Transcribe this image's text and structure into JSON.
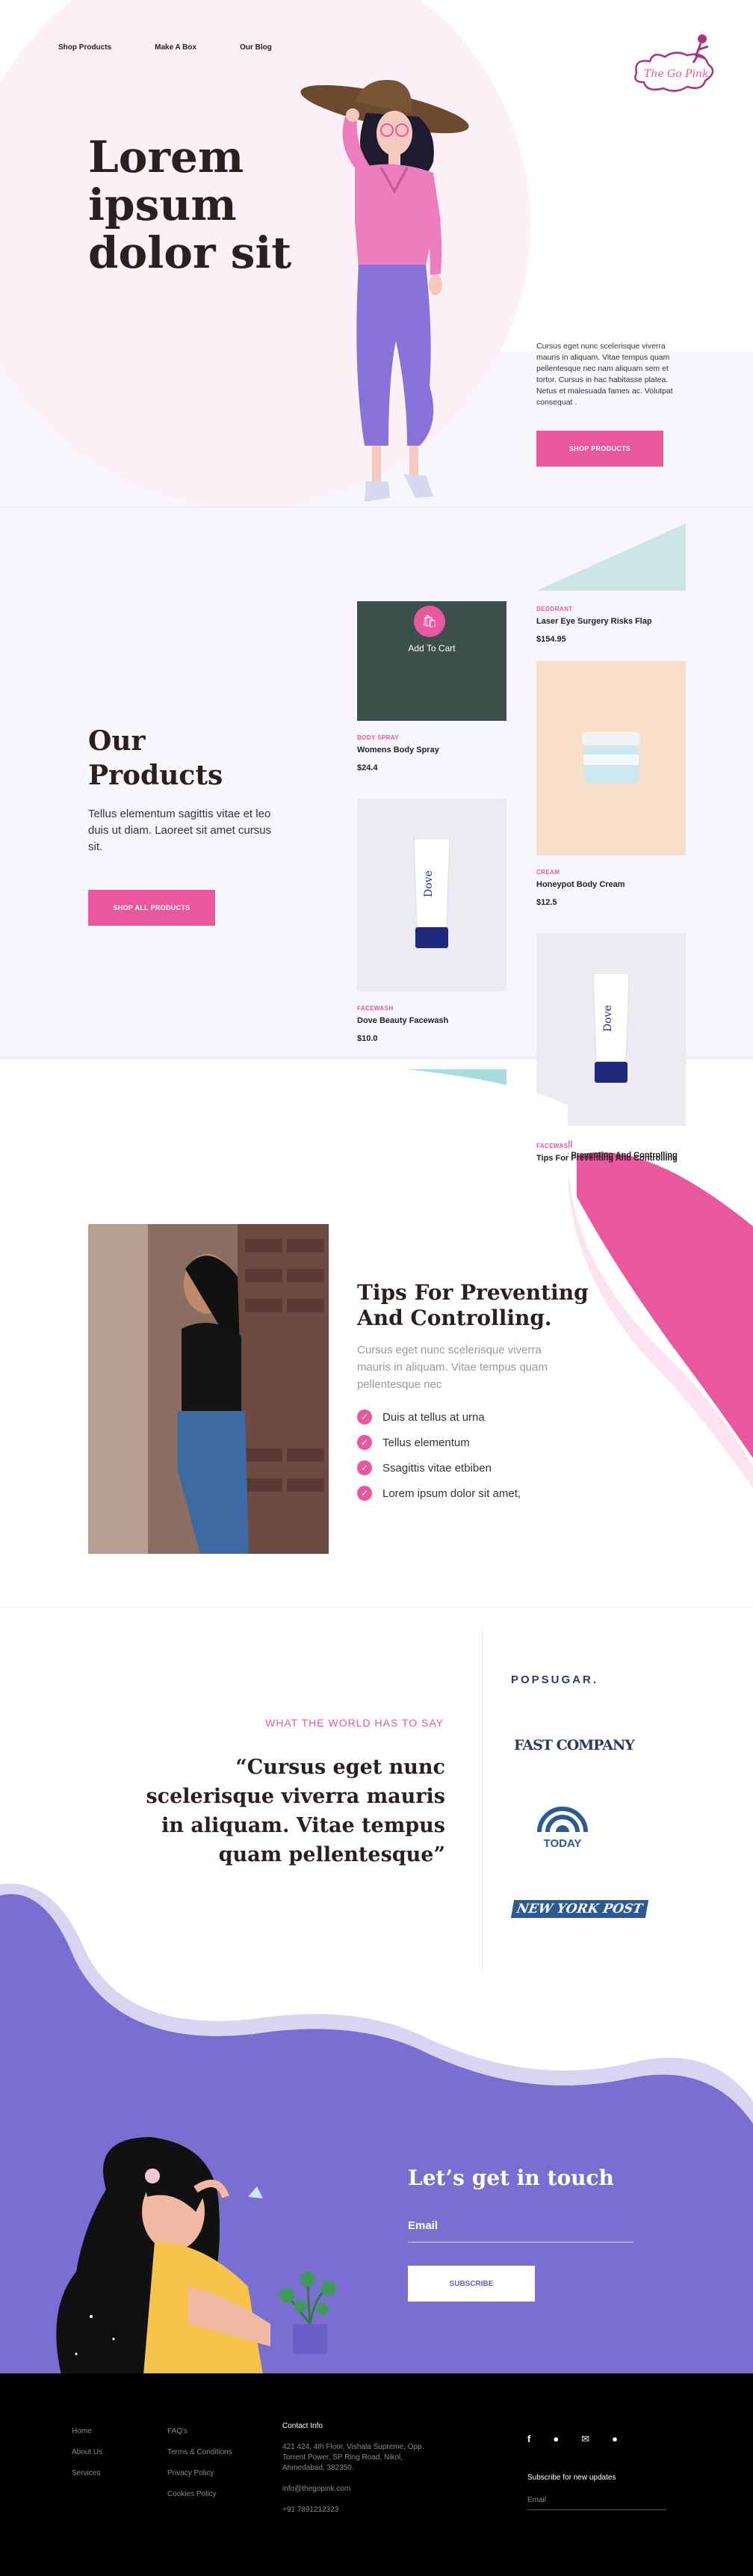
{
  "nav": {
    "items": [
      "Shop Products",
      "Make A Box",
      "Our Blog"
    ]
  },
  "brand": {
    "logo_text": "The Go Pink"
  },
  "hero": {
    "title_lines": [
      "Lorem",
      "ipsum",
      "dolor sit"
    ],
    "description": "Cursus eget nunc scelerisque viverra mauris in aliquam. Vitae tempus quam pellentesque nec nam aliquam sem et tortor. Cursus in hac habitasse platea. Netus et malesuada fames ac. Volutpat consequat .",
    "button": "SHOP PRODUCTS"
  },
  "products_section": {
    "title_lines": [
      "Our",
      "Products"
    ],
    "description": "Tellus elementum sagittis vitae et leo duis ut diam. Laoreet sit amet cursus sit.",
    "button": "SHOP ALL PRODUCTS",
    "add_to_cart": "Add To Cart",
    "items": [
      {
        "category": "DEODRANT",
        "name": "Laser Eye Surgery Risks Flap",
        "price": "$154.95"
      },
      {
        "category": "BODY SPRAY",
        "name": "Womens Body Spray",
        "price": "$24.4"
      },
      {
        "category": "CREAM",
        "name": "Honeypot Body Cream",
        "price": "$12.5"
      },
      {
        "category": "FACEWASH",
        "name": "Dove Beauty Facewash",
        "price": "$10.0"
      },
      {
        "category": "FACEWASH",
        "name": "Tips For Preventing And Controlling",
        "price": ""
      }
    ]
  },
  "tips": {
    "title_lines": [
      "Tips For Preventing",
      "And Controlling."
    ],
    "description": "Cursus eget nunc scelerisque viverra mauris in aliquam. Vitae tempus quam pellentesque nec",
    "list": [
      "Duis at tellus at urna",
      "Tellus elementum",
      "Ssagittis vitae etbiben",
      "Lorem ipsum dolor sit amet,"
    ]
  },
  "press": {
    "eyebrow": "WHAT THE WORLD HAS TO SAY",
    "quote": "“Cursus eget nunc scelerisque viverra mauris in aliquam. Vitae tempus quam pellentesque”",
    "logos": [
      "POPSUGAR.",
      "FAST COMPANY",
      "TODAY",
      "NEW YORK POST"
    ]
  },
  "contact": {
    "title": "Let’s get in touch",
    "email_label": "Email",
    "button": "SUBSCRIBE"
  },
  "footer": {
    "col1": [
      "Home",
      "About Us",
      "Services"
    ],
    "col2": [
      "FAQ's",
      "Terms & Conditions",
      "Privacy Policy",
      "Cookies Policy"
    ],
    "contact_head": "Contact Info",
    "address": [
      "421 424, 4th Floor, Vishala Supreme, Opp.",
      "Torrent Power, SP Ring Road, Nikol,",
      "Ahmedabad, 382350."
    ],
    "email": "info@thegopink.com",
    "phone": "+91 7891212323",
    "subscribe_head": "Subscribe for new updates",
    "email_placeholder": "Email",
    "social_icons": [
      "facebook-icon",
      "whatsapp-icon",
      "mail-icon",
      "chat-icon"
    ]
  },
  "colors": {
    "pink": "#e9579d",
    "purple": "#7a6fd0",
    "light_pink": "#fdf1f7",
    "dark": "#2b1f1f"
  }
}
